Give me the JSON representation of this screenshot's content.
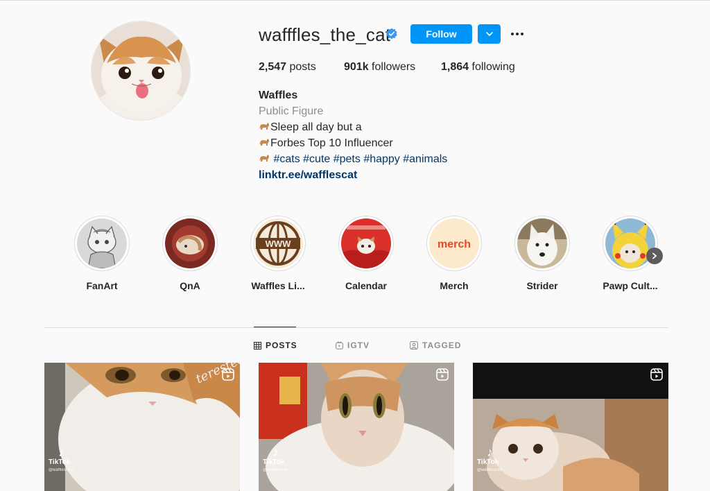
{
  "profile": {
    "username": "wafffles_the_cat",
    "verified": true,
    "follow_label": "Follow",
    "stats": {
      "posts_count": "2,547",
      "posts_label": " posts",
      "followers_count": "901k",
      "followers_label": " followers",
      "following_count": "1,864",
      "following_label": " following"
    },
    "bio": {
      "name": "Waffles",
      "category": "Public Figure",
      "line1": "Sleep all day but a",
      "line2": "Forbes Top 10 Influencer",
      "tags": "#cats #cute #pets #happy #animals",
      "link": "linktr.ee/wafflescat"
    }
  },
  "highlights": [
    {
      "label": "FanArt"
    },
    {
      "label": "QnA"
    },
    {
      "label": "Waffles Li..."
    },
    {
      "label": "Calendar"
    },
    {
      "label": "Merch",
      "image_text": "merch"
    },
    {
      "label": "Strider"
    },
    {
      "label": "Pawp Cult..."
    }
  ],
  "tabs": [
    {
      "label": "POSTS",
      "active": true
    },
    {
      "label": "IGTV",
      "active": false
    },
    {
      "label": "TAGGED",
      "active": false
    }
  ],
  "posts": [
    {
      "brand": "TikTok",
      "handle": "@wafflescute"
    },
    {
      "brand": "TikTok",
      "handle": "@wafflescute"
    },
    {
      "brand": "TikTok",
      "handle": "@wafflescute"
    }
  ],
  "colors": {
    "accent": "#0095f6",
    "link": "#00376b",
    "muted": "#8e8e8e",
    "background": "#fafafa"
  }
}
